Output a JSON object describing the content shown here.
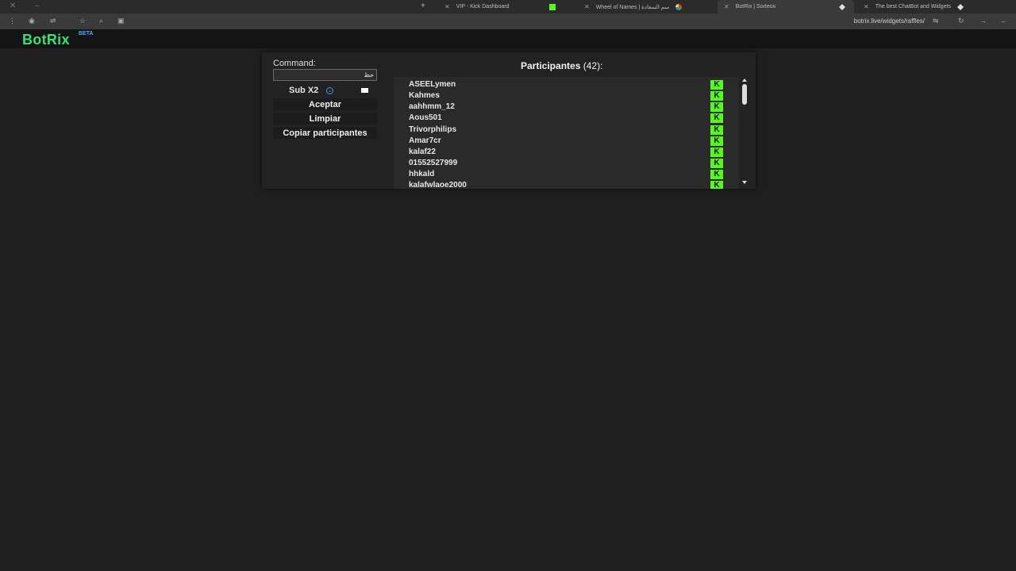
{
  "browser": {
    "tabs": [
      {
        "title": "VIP - Kick Dashboard",
        "favicon": "kick-icon"
      },
      {
        "title": "Wheel of Names | سم السعادة",
        "favicon": "wheel-icon"
      },
      {
        "title": "BotRix | Sorteos",
        "favicon": "botrix-icon"
      },
      {
        "title": "The best ChatBot and Widgets",
        "favicon": "botrix-icon"
      }
    ],
    "url": "botrix.live/widgets/raffles/"
  },
  "app": {
    "logo": "BotRix",
    "badge": "BETA"
  },
  "widget": {
    "command_label": "Command:",
    "command_value": "حظ",
    "sub_label": "Sub X2",
    "accept_label": "Aceptar",
    "clear_label": "Limpiar",
    "copy_label": "Copiar participantes",
    "participants_title": "Participantes",
    "participants_count": "(42):",
    "participants": [
      "ASEELymen",
      "Kahmes",
      "aahhmm_12",
      "Aous501",
      "Trivorphilips",
      "Amar7cr",
      "kalaf22",
      "01552527999",
      "hhkald",
      "kalafwlaoe2000"
    ],
    "platform_badge": "K"
  },
  "colors": {
    "accent": "#53fc18",
    "logo": "#36e07a",
    "background": "#1f1f1f"
  }
}
